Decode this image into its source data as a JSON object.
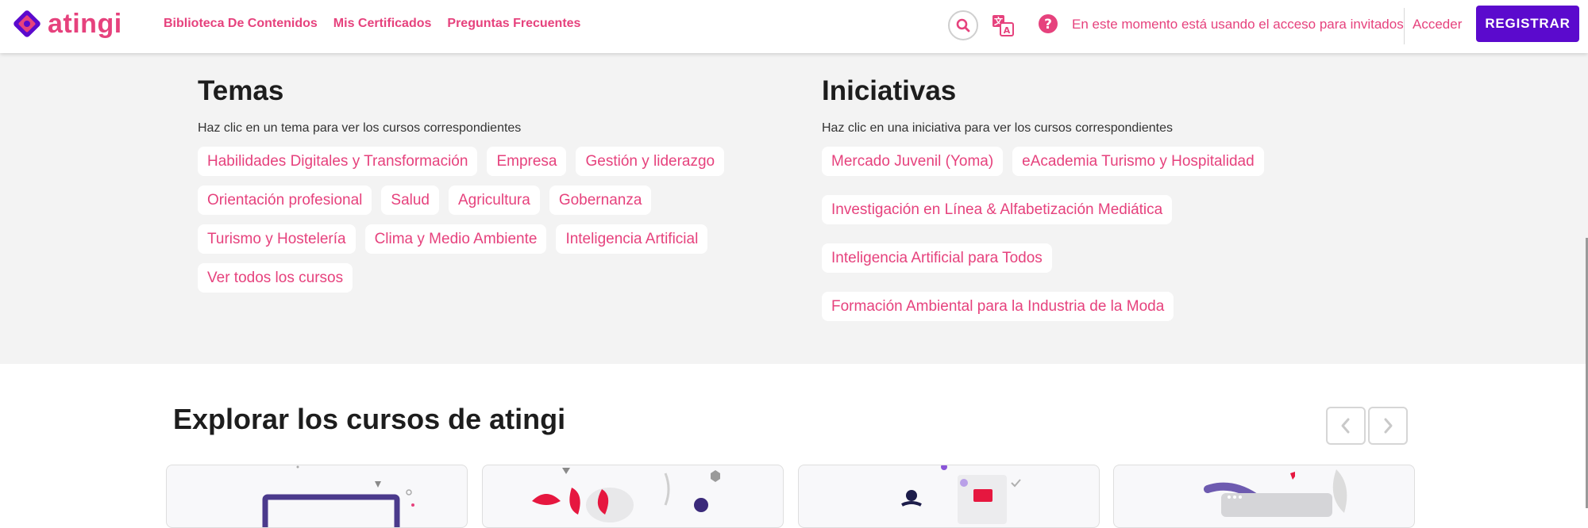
{
  "header": {
    "logo_text": "atingi",
    "nav": [
      {
        "label": "Biblioteca De Contenidos"
      },
      {
        "label": "Mis Certificados"
      },
      {
        "label": "Preguntas Frecuentes"
      }
    ],
    "guest_notice": "En este momento está usando el acceso para invitados",
    "login_label": "Acceder",
    "register_label": "REGISTRAR"
  },
  "topics": {
    "title": "Temas",
    "subtitle": "Haz clic en un tema para ver los cursos correspondientes",
    "items": [
      "Habilidades Digitales y Transformación",
      "Empresa",
      "Gestión y liderazgo",
      "Orientación profesional",
      "Salud",
      "Agricultura",
      "Gobernanza",
      "Turismo y Hostelería",
      "Clima y Medio Ambiente",
      "Inteligencia Artificial",
      "Ver todos los cursos"
    ]
  },
  "initiatives": {
    "title": "Iniciativas",
    "subtitle": "Haz clic en una iniciativa para ver los cursos correspondientes",
    "items": [
      "Mercado Juvenil (Yoma)",
      "eAcademia Turismo y Hospitalidad",
      "Investigación en Línea & Alfabetización Mediática",
      "Inteligencia Artificial para Todos",
      "Formación Ambiental para la Industria de la Moda"
    ]
  },
  "explore": {
    "title": "Explorar los cursos de atingi"
  },
  "colors": {
    "brand_pink": "#e6427d",
    "brand_purple": "#5b0acd",
    "section_bg": "#f3f3f3"
  },
  "icons": {
    "search": "search-icon",
    "translate": "translate-icon",
    "help": "help-icon",
    "prev": "chevron-left-icon",
    "next": "chevron-right-icon"
  }
}
